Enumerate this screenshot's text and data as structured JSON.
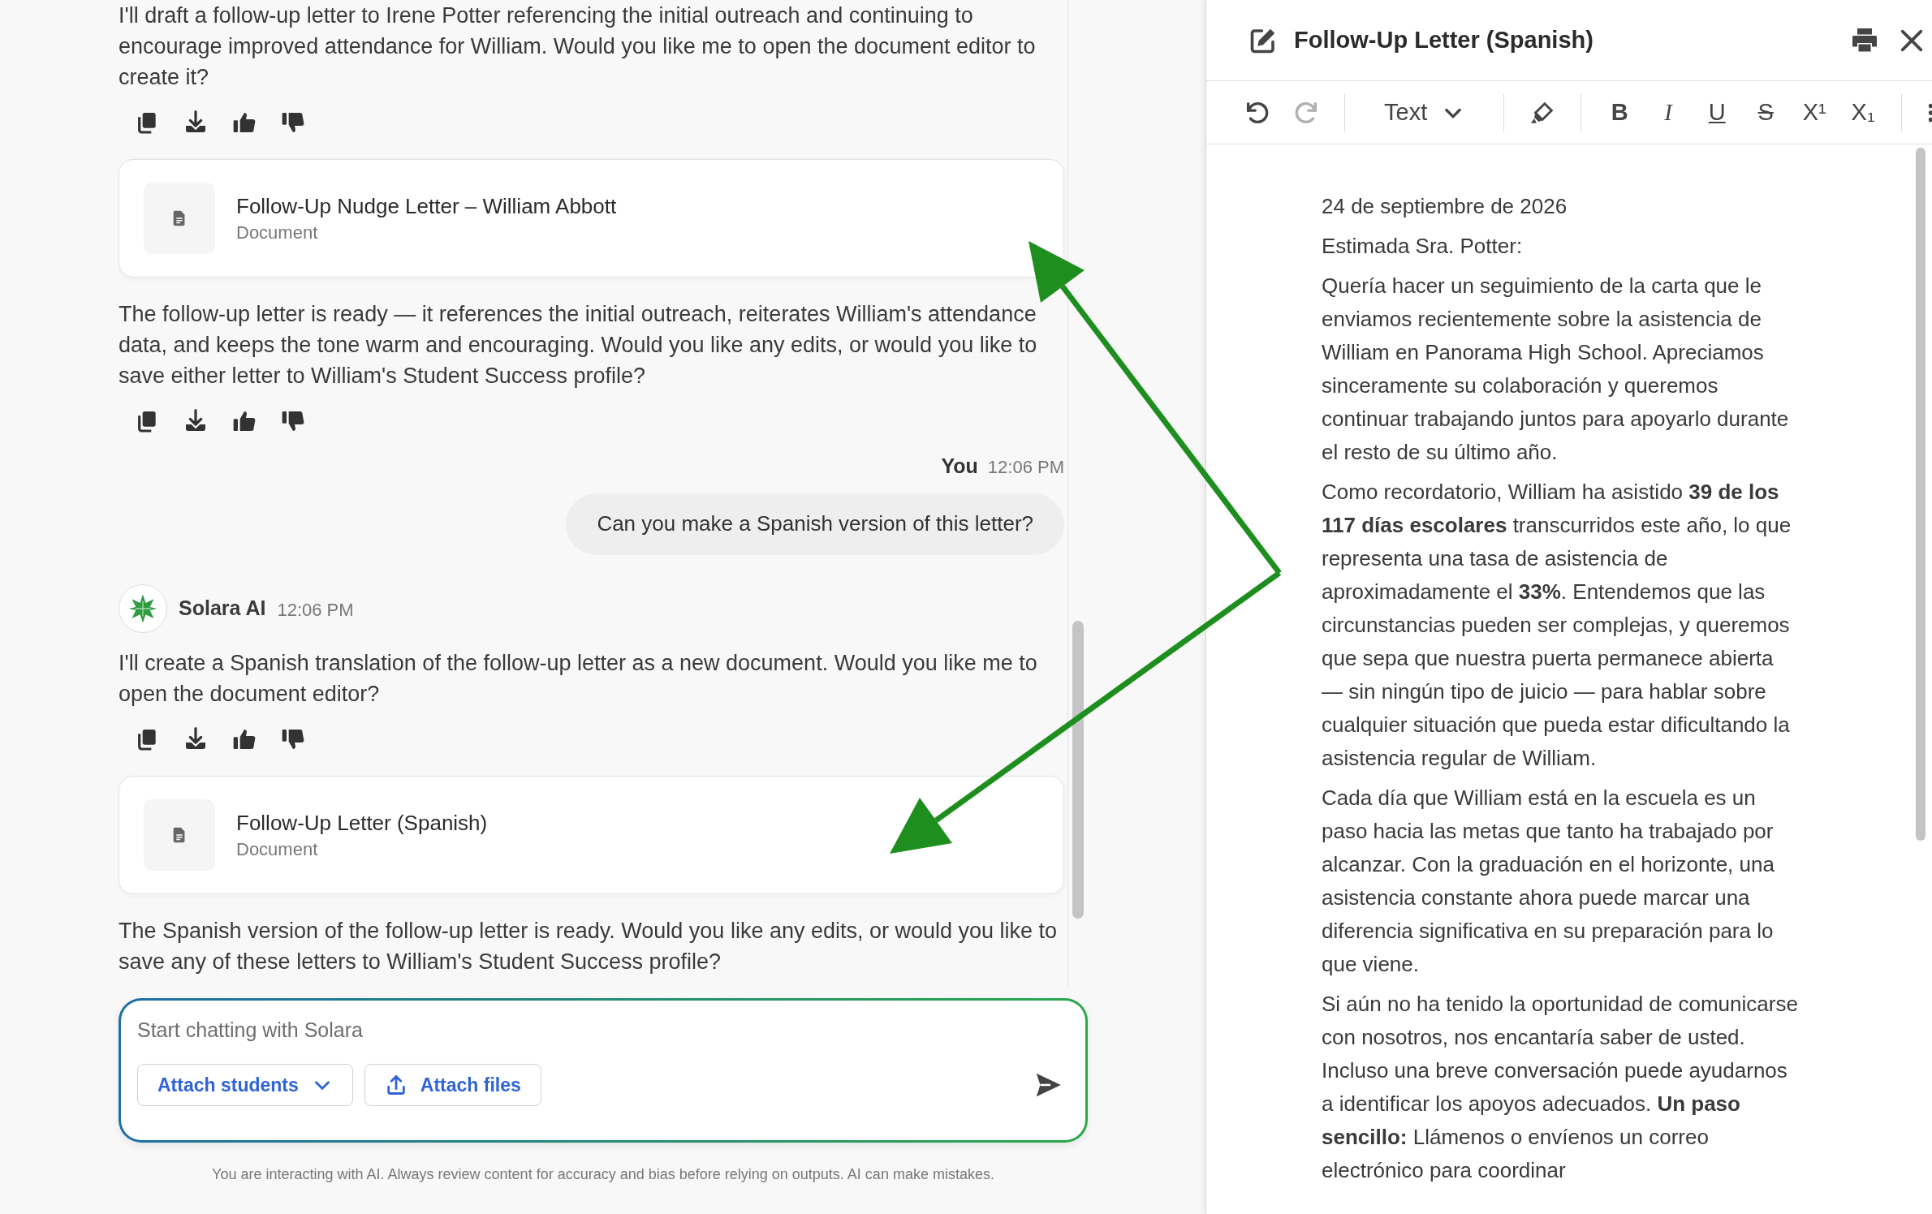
{
  "chat": {
    "messages": [
      {
        "kind": "ai_text",
        "text": "I'll draft a follow-up letter to Irene Potter referencing the initial outreach and continuing to encourage improved attendance for William. Would you like me to open the document editor to create it?",
        "show_actions": true
      },
      {
        "kind": "document",
        "title": "Follow-Up Nudge Letter – William Abbott",
        "subtitle": "Document"
      },
      {
        "kind": "ai_text",
        "text": "The follow-up letter is ready — it references the initial outreach, reiterates William's attendance data, and keeps the tone warm and encouraging. Would you like any edits, or would you like to save either letter to William's Student Success profile?",
        "show_actions": true
      },
      {
        "kind": "user",
        "author": "You",
        "time": "12:06 PM",
        "text": "Can you make a Spanish version of this letter?"
      },
      {
        "kind": "ai_header",
        "author": "Solara AI",
        "time": "12:06 PM"
      },
      {
        "kind": "ai_text",
        "text": "I'll create a Spanish translation of the follow-up letter as a new document. Would you like me to open the document editor?",
        "show_actions": true
      },
      {
        "kind": "document",
        "title": "Follow-Up Letter (Spanish)",
        "subtitle": "Document"
      },
      {
        "kind": "ai_text",
        "text": "The Spanish version of the follow-up letter is ready. Would you like any edits, or would you like to save any of these letters to William's Student Success profile?",
        "show_actions": false
      }
    ],
    "input": {
      "placeholder": "Start chatting with Solara",
      "buttons": [
        {
          "kind": "dropdown",
          "label": "Attach students"
        },
        {
          "kind": "upload",
          "label": "Attach files"
        }
      ]
    },
    "disclaimer": "You are interacting with AI. Always review content for accuracy and bias before relying on outputs. AI can make mistakes."
  },
  "editor": {
    "title": "Follow-Up Letter (Spanish)",
    "toolbar": [
      {
        "kind": "undo",
        "disabled": false
      },
      {
        "kind": "redo",
        "disabled": true
      },
      {
        "kind": "divider"
      },
      {
        "kind": "dropdown",
        "label": "Text"
      },
      {
        "kind": "divider"
      },
      {
        "kind": "highlight",
        "disabled": false
      },
      {
        "kind": "divider"
      },
      {
        "kind": "bold",
        "label": "B"
      },
      {
        "kind": "italic",
        "label": "I"
      },
      {
        "kind": "underline",
        "label": "U"
      },
      {
        "kind": "strike",
        "label": "S"
      },
      {
        "kind": "superscript",
        "label": "X¹"
      },
      {
        "kind": "subscript",
        "label": "X₁"
      },
      {
        "kind": "divider"
      },
      {
        "kind": "list",
        "disabled": false
      }
    ],
    "paragraphs": [
      "24 de septiembre de 2026",
      "Estimada Sra. Potter:",
      "Quería hacer un seguimiento de la carta que le enviamos recientemente sobre la asistencia de William en Panorama High School. Apreciamos sinceramente su colaboración y queremos continuar trabajando juntos para apoyarlo durante el resto de su último año.",
      "Como recordatorio, William ha asistido **39 de los 117 días escolares** transcurridos este año, lo que representa una tasa de asistencia de aproximadamente el **33%**. Entendemos que las circunstancias pueden ser complejas, y queremos que sepa que nuestra puerta permanece abierta — sin ningún tipo de juicio — para hablar sobre cualquier situación que pueda estar dificultando la asistencia regular de William.",
      "Cada día que William está en la escuela es un paso hacia las metas que tanto ha trabajado por alcanzar. Con la graduación en el horizonte, una asistencia constante ahora puede marcar una diferencia significativa en su preparación para lo que viene.",
      "Si aún no ha tenido la oportunidad de comunicarse con nosotros, nos encantaría saber de usted. Incluso una breve conversación puede ayudarnos a identificar los apoyos adecuados. **Un paso sencillo:** Llámenos o envíenos un correo electrónico para coordinar"
    ]
  }
}
